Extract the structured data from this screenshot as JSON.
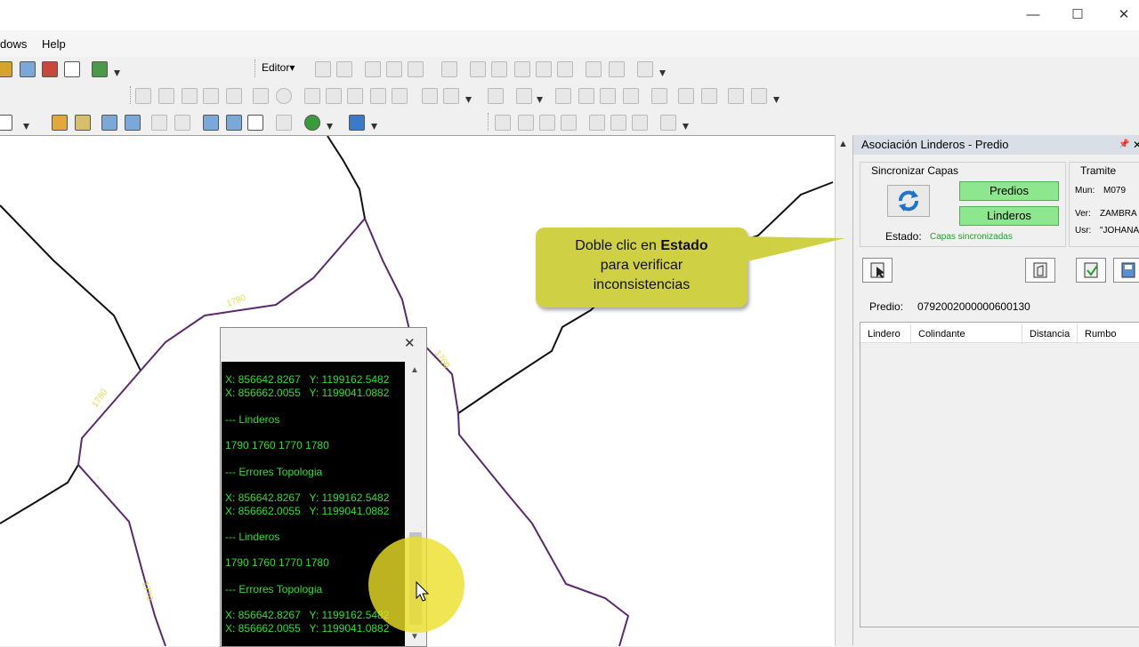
{
  "window": {
    "minimize": "—",
    "maximize": "☐",
    "close": "✕"
  },
  "menu": {
    "items": [
      "dows",
      "Help"
    ]
  },
  "toolbar": {
    "editor_label": "Editor▾"
  },
  "map": {
    "labels": [
      "1790",
      "1780",
      "1760",
      "1770"
    ]
  },
  "callout": {
    "line1_prefix": "Doble clic en ",
    "line1_bold": "Estado",
    "line2": "para verificar",
    "line3": "inconsistencias"
  },
  "dialog": {
    "close": "✕",
    "lines": [
      "X: 856642.8267   Y: 1199162.5482",
      "X: 856662.0055   Y: 1199041.0882",
      "--- Linderos",
      "1790 1760 1770 1780",
      "--- Errores Topologia",
      "X: 856642.8267   Y: 1199162.5482",
      "X: 856662.0055   Y: 1199041.0882",
      "--- Linderos",
      "1790 1760 1770 1780",
      "--- Errores Topologia",
      "X: 856642.8267   Y: 1199162.5482",
      "X: 856662.0055   Y: 1199041.0882"
    ]
  },
  "panel": {
    "title": "Asociación Linderos -  Predio",
    "pin": "📌",
    "close": "✕",
    "sync_group": "Sincronizar Capas",
    "predios_btn": "Predios",
    "linderos_btn": "Linderos",
    "estado_label": "Estado:",
    "estado_value": "Capas sincronizadas",
    "tramite_group": "Tramite",
    "mun_label": "Mun:",
    "mun_value": "M079",
    "ver_label": "Ver:",
    "ver_value": "ZAMBRA",
    "usr_label": "Usr:",
    "usr_value": "\"JOHANA",
    "predio_label": "Predio:",
    "predio_value": "0792002000000600130",
    "columns": [
      "Lindero",
      "Colindante",
      "Distancia",
      "Rumbo"
    ]
  }
}
